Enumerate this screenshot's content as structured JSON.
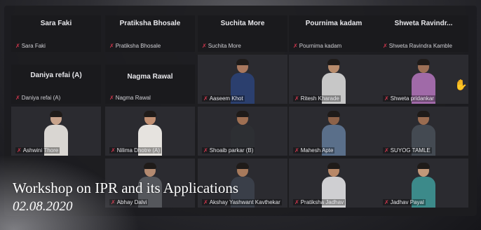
{
  "caption": {
    "title": "Workshop on IPR and its Applications",
    "date": "02.08.2020"
  },
  "row1": [
    {
      "big": "Sara Faki",
      "small": "Sara Faki"
    },
    {
      "big": "Pratiksha Bhosale",
      "small": "Pratiksha Bhosale"
    },
    {
      "big": "Suchita More",
      "small": "Suchita More"
    },
    {
      "big": "Pournima kadam",
      "small": "Pournima kadam"
    },
    {
      "big": "Shweta  Ravindr...",
      "small": "Shweta Ravindra Kamble"
    }
  ],
  "row2_tiles": [
    {
      "big": "Daniya refai (A)",
      "small": "Daniya refai (A)"
    },
    {
      "big": "Nagma Rawal",
      "small": "Nagma Rawal"
    }
  ],
  "row2_videos": [
    {
      "small": "Aaseem Khot",
      "skin": "#a9785e",
      "shirt": "#2b3f6e"
    },
    {
      "small": "Ritesh Kharade",
      "skin": "#b88c6c",
      "shirt": "#c7c7c7"
    },
    {
      "small": "Shweta pridankar",
      "skin": "#9d7056",
      "shirt": "#a06aa8"
    }
  ],
  "row3_videos": [
    {
      "small": "Ashwini Thore",
      "skin": "#c8a48c",
      "shirt": "#d9d6d2"
    },
    {
      "small": "Nilima Dhotre (A)",
      "skin": "#c19073",
      "shirt": "#e6e3df"
    },
    {
      "small": "Shoaib parkar (B)",
      "skin": "#9e6f52",
      "shirt": "#2d2f33"
    },
    {
      "small": "Mahesh Apte",
      "skin": "#8d6248",
      "shirt": "#5a6f8a"
    },
    {
      "small": "SUYOG TAMLE",
      "skin": "#9a6c50",
      "shirt": "#444a52"
    }
  ],
  "row4_videos": [
    {
      "small": "Abhay Dalvi",
      "skin": "#b48a70",
      "shirt": "#55575c"
    },
    {
      "small": "Akshay Yashwant Kavthekar",
      "skin": "#a77a5c",
      "shirt": "#3a3f49"
    },
    {
      "small": "Pratiksha Jadhav",
      "skin": "#b88868",
      "shirt": "#cfcfd2"
    },
    {
      "small": "Jadhav Payal",
      "skin": "#c39879",
      "shirt": "#3c8a8a"
    }
  ],
  "raise_hand": "hand-raised-icon"
}
